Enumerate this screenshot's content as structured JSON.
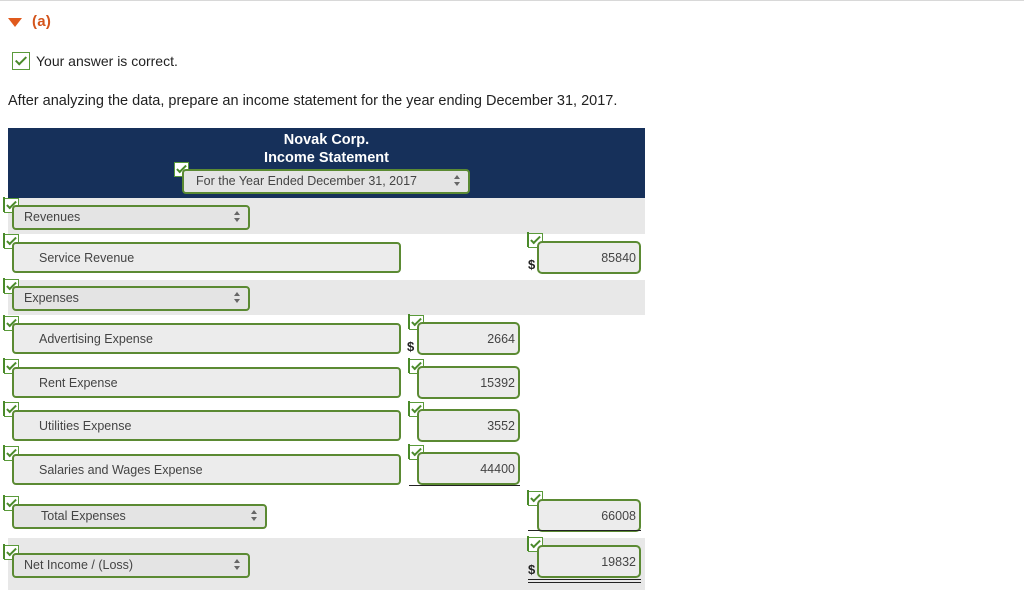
{
  "section": {
    "label": "(a)"
  },
  "status": {
    "message": "Your answer is correct."
  },
  "instructions": "After analyzing the data, prepare an income statement for the year ending December 31, 2017.",
  "statement": {
    "company": "Novak Corp.",
    "title": "Income Statement",
    "period": "For the Year Ended December 31, 2017"
  },
  "rows": {
    "revenues_label": "Revenues",
    "service_revenue_label": "Service Revenue",
    "service_revenue_value": "85840",
    "expenses_label": "Expenses",
    "advertising_label": "Advertising Expense",
    "advertising_value": "2664",
    "rent_label": "Rent Expense",
    "rent_value": "15392",
    "utilities_label": "Utilities Expense",
    "utilities_value": "3552",
    "salaries_label": "Salaries and Wages Expense",
    "salaries_value": "44400",
    "total_expenses_label": "Total Expenses",
    "total_expenses_value": "66008",
    "net_income_label": "Net Income / (Loss)",
    "net_income_value": "19832"
  },
  "currency_symbol": "$",
  "colors": {
    "header_bg": "#16305a",
    "section_accent": "#d4551c",
    "correct_border": "#5b8a33",
    "band_bg": "#e8e8e8"
  },
  "icons": [
    "collapse-triangle-icon",
    "checkmark-icon",
    "select-arrows-icon"
  ]
}
